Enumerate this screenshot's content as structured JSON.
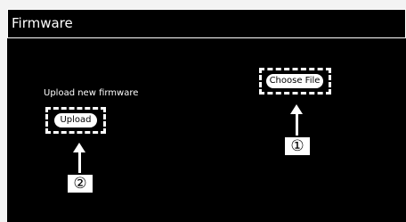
{
  "header": {
    "title": "Firmware"
  },
  "upload_section": {
    "label": "Upload new firmware"
  },
  "buttons": {
    "choose_file": "Choose File",
    "upload": "Upload"
  },
  "callouts": {
    "one": "①",
    "two": "②"
  },
  "colors": {
    "panel_background": "#000000",
    "foreground": "#ffffff",
    "page_background": "#f3f3f3"
  }
}
